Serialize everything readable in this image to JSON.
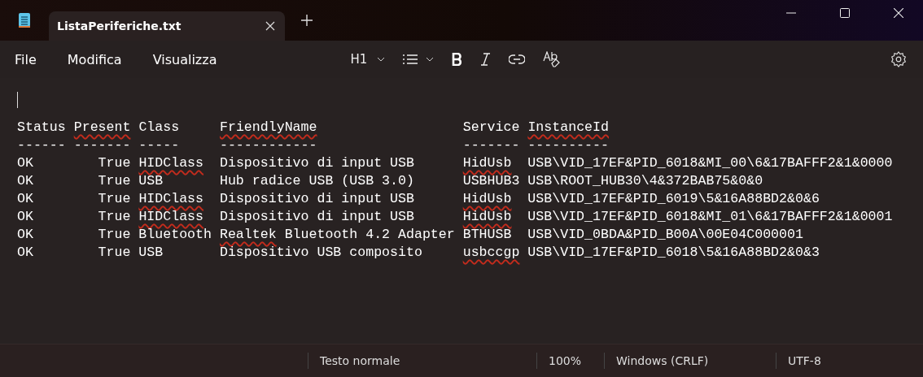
{
  "tabs": [
    {
      "label": "ListaPeriferiche.txt",
      "selected": true
    }
  ],
  "menu": [
    "File",
    "Modifica",
    "Visualizza"
  ],
  "toolbar": {
    "heading": "H1"
  },
  "editor": {
    "lines": [
      [
        {
          "text": "Status ",
          "misspelled": false
        },
        {
          "text": "Present",
          "misspelled": true
        },
        {
          "text": " Class     ",
          "misspelled": false
        },
        {
          "text": "FriendlyName",
          "misspelled": true
        },
        {
          "text": "                  Service ",
          "misspelled": false
        },
        {
          "text": "InstanceId",
          "misspelled": true
        }
      ],
      [
        {
          "text": "------ ------- -----     ------------                  ------- ----------",
          "misspelled": false
        }
      ],
      [
        {
          "text": "OK        True ",
          "misspelled": false
        },
        {
          "text": "HIDClass",
          "misspelled": true
        },
        {
          "text": "  Dispositivo di input USB      ",
          "misspelled": false
        },
        {
          "text": "HidUsb",
          "misspelled": true
        },
        {
          "text": "  USB\\VID_17EF&PID_6018&MI_00\\6&17BAFFF2&1&0000",
          "misspelled": false
        }
      ],
      [
        {
          "text": "OK        True USB       Hub radice USB (USB 3.0)      USBHUB3 USB\\ROOT_HUB30\\4&372BAB75&0&0",
          "misspelled": false
        }
      ],
      [
        {
          "text": "OK        True ",
          "misspelled": false
        },
        {
          "text": "HIDClass",
          "misspelled": true
        },
        {
          "text": "  Dispositivo di input USB      ",
          "misspelled": false
        },
        {
          "text": "HidUsb",
          "misspelled": true
        },
        {
          "text": "  USB\\VID_17EF&PID_6019\\5&16A88BD2&0&6",
          "misspelled": false
        }
      ],
      [
        {
          "text": "OK        True ",
          "misspelled": false
        },
        {
          "text": "HIDClass",
          "misspelled": true
        },
        {
          "text": "  Dispositivo di input USB      ",
          "misspelled": false
        },
        {
          "text": "HidUsb",
          "misspelled": true
        },
        {
          "text": "  USB\\VID_17EF&PID_6018&MI_01\\6&17BAFFF2&1&0001",
          "misspelled": false
        }
      ],
      [
        {
          "text": "OK        True Bluetooth ",
          "misspelled": false
        },
        {
          "text": "Realtek",
          "misspelled": true
        },
        {
          "text": " Bluetooth 4.2 Adapter BTHUSB  USB\\VID_0BDA&PID_B00A\\00E04C000001",
          "misspelled": false
        }
      ],
      [
        {
          "text": "OK        True USB       Dispositivo USB composito     ",
          "misspelled": false
        },
        {
          "text": "usbccgp",
          "misspelled": true
        },
        {
          "text": " USB\\VID_17EF&PID_6018\\5&16A88BD2&0&3",
          "misspelled": false
        }
      ]
    ]
  },
  "status_bar": [
    "Testo normale",
    "100%",
    "Windows (CRLF)",
    "UTF-8"
  ]
}
